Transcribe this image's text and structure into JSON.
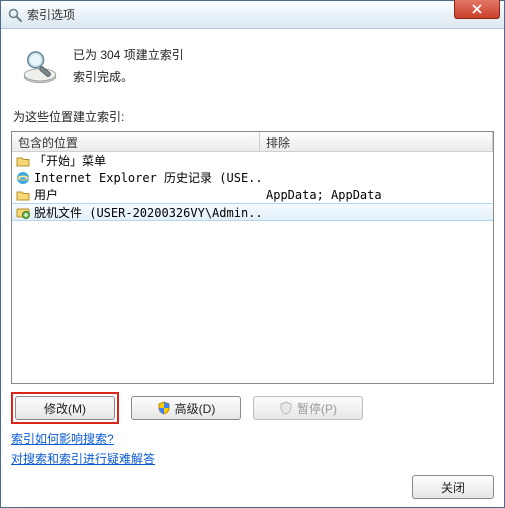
{
  "window": {
    "title": "索引选项"
  },
  "status": {
    "line1": "已为 304 项建立索引",
    "line2": "索引完成。"
  },
  "section_label": "为这些位置建立索引:",
  "columns": {
    "included": "包含的位置",
    "excluded": "排除"
  },
  "rows": [
    {
      "icon": "folder",
      "name": "「开始」菜单",
      "exclude": ""
    },
    {
      "icon": "ie",
      "name": "Internet Explorer 历史记录 (USE...",
      "exclude": ""
    },
    {
      "icon": "folder",
      "name": "用户",
      "exclude": "AppData; AppData"
    },
    {
      "icon": "offline",
      "name": "脱机文件 (USER-20200326VY\\Admin...",
      "exclude": "",
      "selected": true
    }
  ],
  "buttons": {
    "modify": "修改(M)",
    "advanced": "高级(D)",
    "pause": "暂停(P)",
    "close": "关闭"
  },
  "links": {
    "help1": "索引如何影响搜索?",
    "help2": "对搜索和索引进行疑难解答"
  }
}
